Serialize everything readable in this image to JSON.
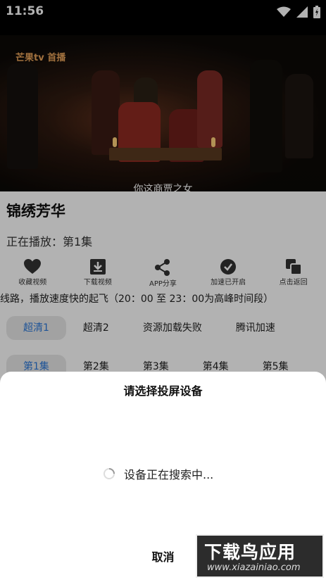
{
  "status_bar": {
    "time": "11:56"
  },
  "video": {
    "logo_text": "芒果tv 首播",
    "subtitle": "你这商贾之女"
  },
  "show": {
    "title": "锦绣芳华",
    "now_playing": "正在播放：第1集"
  },
  "actions": [
    {
      "label": "收藏视频",
      "icon": "heart-icon"
    },
    {
      "label": "下载视频",
      "icon": "download-icon"
    },
    {
      "label": "APP分享",
      "icon": "share-icon"
    },
    {
      "label": "加速已开启",
      "icon": "check-circle-icon"
    },
    {
      "label": "点击返回",
      "icon": "return-icon"
    }
  ],
  "notice": "线路，播放速度快的起飞（20：00 至 23：00为高峰时间段）",
  "lines": [
    {
      "label": "超清1",
      "active": true
    },
    {
      "label": "超清2",
      "active": false
    },
    {
      "label": "资源加载失败",
      "active": false
    },
    {
      "label": "腾讯加速",
      "active": false
    }
  ],
  "episodes": [
    {
      "label": "第1集",
      "active": true
    },
    {
      "label": "第2集",
      "active": false
    },
    {
      "label": "第3集",
      "active": false
    },
    {
      "label": "第4集",
      "active": false
    },
    {
      "label": "第5集",
      "active": false
    }
  ],
  "dialog": {
    "title": "请选择投屏设备",
    "searching_text": "设备正在搜索中...",
    "cancel_label": "取消"
  },
  "watermark": {
    "main": "下载鸟应用",
    "url": "www.xiazainiao.com"
  },
  "colors": {
    "accent": "#2b78d9",
    "status_bar": "#000000"
  }
}
